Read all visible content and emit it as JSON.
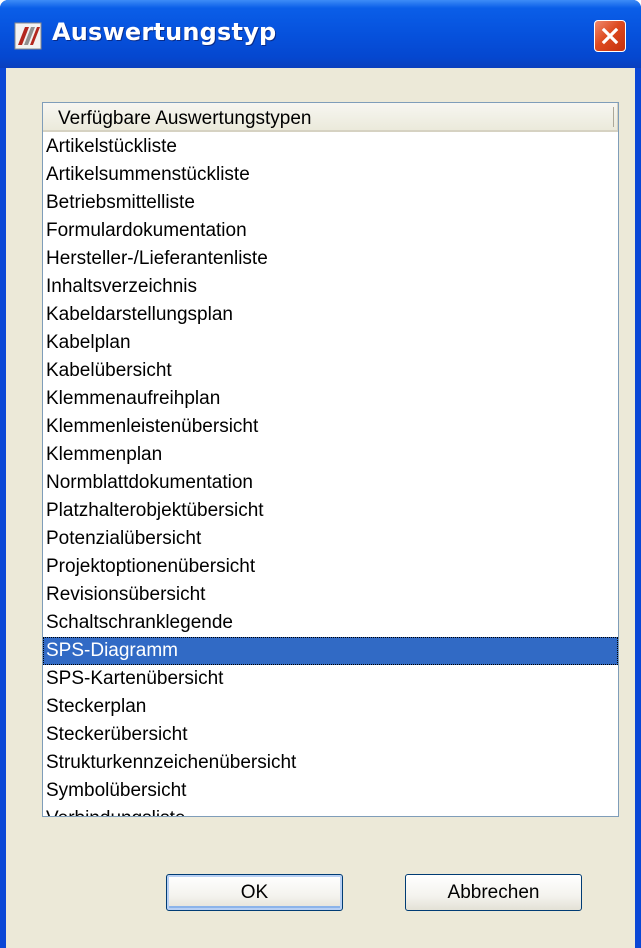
{
  "window": {
    "title": "Auswertungstyp",
    "icon": "app-logo-icon",
    "close_icon": "close-icon"
  },
  "list": {
    "header": "Verfügbare Auswertungstypen",
    "items": [
      "Artikelstückliste",
      "Artikelsummenstückliste",
      "Betriebsmittelliste",
      "Formulardokumentation",
      "Hersteller-/Lieferantenliste",
      "Inhaltsverzeichnis",
      "Kabeldarstellungsplan",
      "Kabelplan",
      "Kabelübersicht",
      "Klemmenaufreihplan",
      "Klemmenleistenübersicht",
      "Klemmenplan",
      "Normblattdokumentation",
      "Platzhalterobjektübersicht",
      "Potenzialübersicht",
      "Projektoptionenübersicht",
      "Revisionsübersicht",
      "Schaltschranklegende",
      "SPS-Diagramm",
      "SPS-Kartenübersicht",
      "Steckerplan",
      "Steckerübersicht",
      "Strukturkennzeichenübersicht",
      "Symbolübersicht",
      "Verbindungsliste"
    ],
    "selected": "SPS-Diagramm"
  },
  "buttons": {
    "ok": "OK",
    "cancel": "Abbrechen"
  },
  "colors": {
    "titlebar": "#0650db",
    "selection": "#316ac5",
    "dialog_bg": "#ece9d8"
  }
}
